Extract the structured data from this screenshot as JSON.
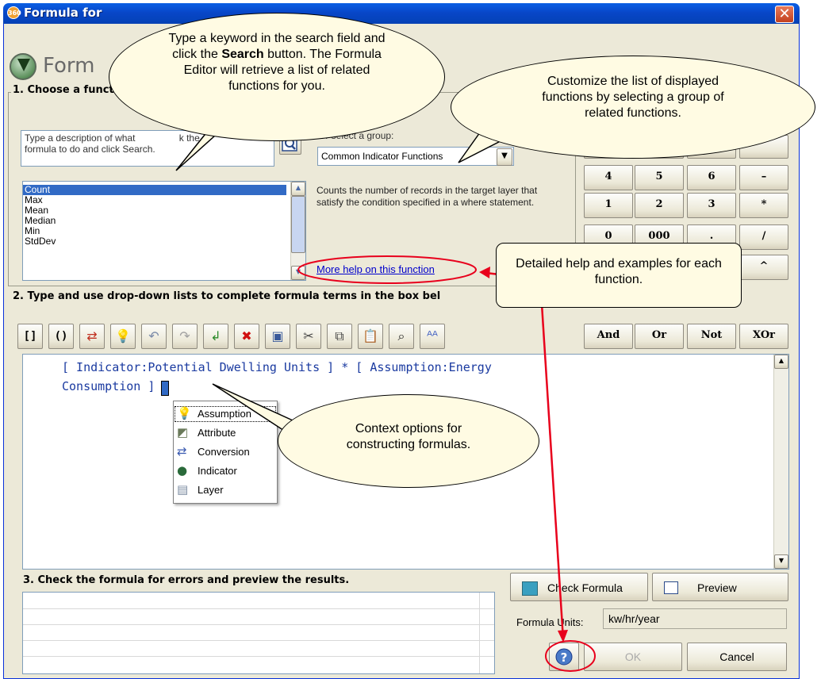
{
  "window": {
    "title": "Formula for"
  },
  "header": {
    "title": "Form"
  },
  "section1": {
    "label": "1. Choose a functio",
    "search_placeholder": "Type a description of what",
    "search_placeholder_cont": "k the",
    "search_placeholder_line2": "formula to do and click Search.",
    "group_label": "Or select a group:",
    "group_value": "Common Indicator Functions",
    "functions": [
      "Count",
      "Max",
      "Mean",
      "Median",
      "Min",
      "StdDev"
    ],
    "selected_function": "Count",
    "description": "Counts the number of records in the target layer that satisfy the condition specified in a where statement.",
    "help_link": "More help on this function"
  },
  "keypad": {
    "row1": [
      "4",
      "5",
      "6",
      "–"
    ],
    "row2": [
      "1",
      "2",
      "3",
      "*"
    ],
    "row3": [
      "0",
      "000",
      ".",
      "/"
    ],
    "caret": "^",
    "logic": [
      "And",
      "Or",
      "Not",
      "XOr"
    ]
  },
  "section2": {
    "label": "2. Type and use drop-down lists to complete formula terms in the box bel",
    "toolbar": [
      "[]",
      "()",
      "conversion-icon",
      "assumption-icon",
      "undo-icon",
      "redo-icon",
      "insert-icon",
      "delete-icon",
      "paste-icon",
      "cut-icon",
      "copy-icon",
      "clipboard-icon",
      "find-icon",
      "replace-icon"
    ],
    "formula_line1": "[ Indicator:Potential Dwelling Units ] * [ Assumption:Energy",
    "formula_line2": "Consumption ]",
    "context_menu": [
      "Assumption",
      "Attribute",
      "Conversion",
      "Indicator",
      "Layer"
    ]
  },
  "section3": {
    "label": "3. Check the formula for errors and preview the results.",
    "check_button": "Check Formula",
    "preview_button": "Preview",
    "units_label": "Formula Units:",
    "units_value": "kw/hr/year",
    "ok_button": "OK",
    "cancel_button": "Cancel"
  },
  "callouts": {
    "search_pre": "Type a keyword in the search field and click the ",
    "search_bold": "Search",
    "search_post": " button.  The Formula Editor will retrieve a list of related functions for you.",
    "group": "Customize the list of displayed functions by selecting a group of related functions.",
    "help": "Detailed help and examples for each function.",
    "context": "Context options for constructing formulas."
  },
  "colors": {
    "title_bar": "#0846c8",
    "selection": "#316ac5",
    "callout_fill": "#fffbe3",
    "annotation_red": "#e8001c"
  }
}
